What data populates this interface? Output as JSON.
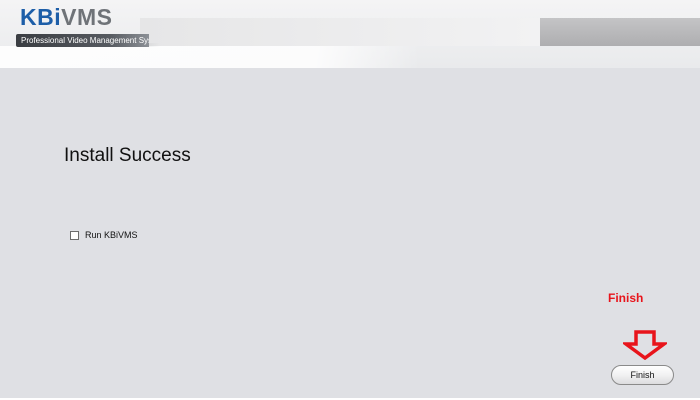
{
  "header": {
    "logo_kb": "KB",
    "logo_i": "i",
    "logo_vms": "VMS",
    "tagline": "Professional Video Management System"
  },
  "main": {
    "title": "Install Success",
    "run_checkbox": {
      "label": "Run KBiVMS",
      "checked": false
    }
  },
  "annotation": {
    "text": "Finish",
    "color": "#e8141b",
    "icon": "down-arrow-icon"
  },
  "footer": {
    "finish_label": "Finish"
  },
  "colors": {
    "background": "#dfe0e4",
    "brand_blue": "#1d5ea8",
    "brand_gray": "#6f7378"
  }
}
